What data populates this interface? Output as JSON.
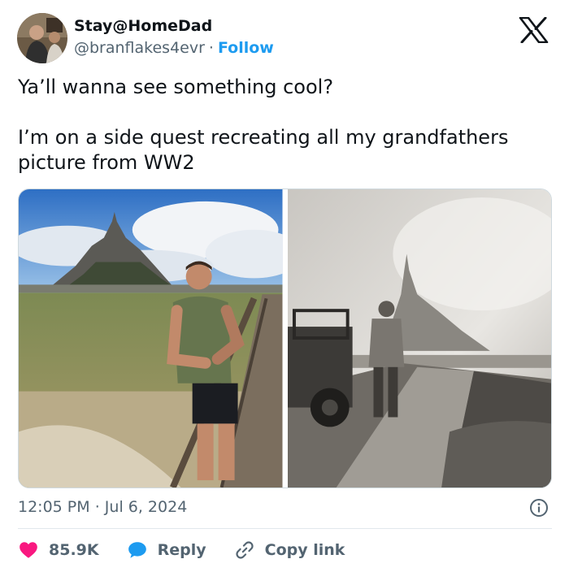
{
  "author": {
    "display_name": "Stay@HomeDad",
    "handle": "@branflakes4evr",
    "separator": "·",
    "follow_label": "Follow"
  },
  "tweet": {
    "line1": "Ya’ll wanna see something cool?",
    "line2": "I’m on a side quest recreating all my grandfathers picture from WW2"
  },
  "meta": {
    "time": "12:05 PM",
    "separator": "·",
    "date": "Jul 6, 2024"
  },
  "actions": {
    "likes": "85.9K",
    "reply_label": "Reply",
    "copy_label": "Copy link"
  },
  "icons": {
    "logo": "x-logo-icon",
    "info": "info-icon",
    "like": "heart-icon",
    "reply": "speech-bubble-icon",
    "copy": "link-icon"
  },
  "colors": {
    "text": "#0f1419",
    "secondary": "#536471",
    "accent": "#1d9bf0",
    "like": "#f91880"
  }
}
